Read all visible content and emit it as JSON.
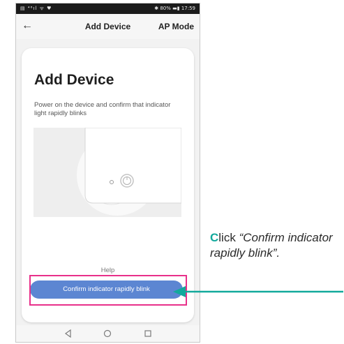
{
  "status_bar": {
    "left": "▤ ⁴⁶ıl ᯤ ♥",
    "right": "✱ 80% ▬▮ 17:59"
  },
  "header": {
    "back_icon": "back-arrow-icon",
    "title": "Add Device",
    "mode": "AP Mode"
  },
  "card": {
    "title": "Add Device",
    "description": "Power on the device and confirm that indicator light rapidly blinks",
    "help_label": "Help",
    "confirm_label": "Confirm indicator rapidly blink"
  },
  "android_nav": {
    "back_icon": "triangle-back-icon",
    "home_icon": "circle-home-icon",
    "recent_icon": "square-recent-icon"
  },
  "callout": {
    "cap": "C",
    "rest": "lick ",
    "quote": "“Confirm indicator rapidly blink”.",
    "accent_color": "#12a99c"
  },
  "highlight_color": "#e8308a",
  "button_color": "#5c86d2"
}
